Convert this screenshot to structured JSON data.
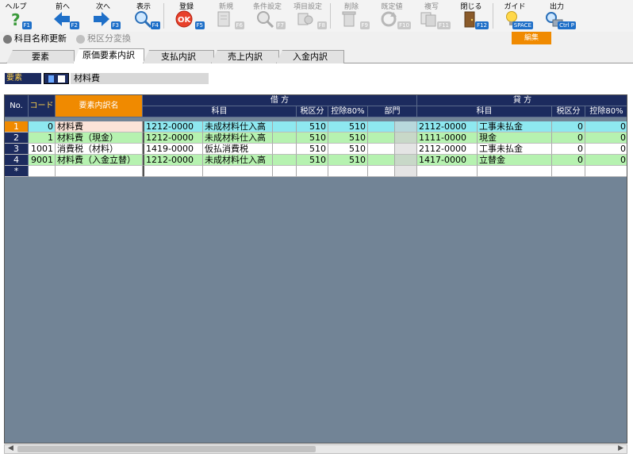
{
  "toolbar": {
    "help": {
      "label": "ヘルプ",
      "key": "F1"
    },
    "prev": {
      "label": "前へ",
      "key": "F2"
    },
    "next": {
      "label": "次へ",
      "key": "F3"
    },
    "view": {
      "label": "表示",
      "key": "F4"
    },
    "register": {
      "label": "登録",
      "key": "F5"
    },
    "new": {
      "label": "新規",
      "key": "F6"
    },
    "condition": {
      "label": "条件設定",
      "key": "F7"
    },
    "item": {
      "label": "項目設定",
      "key": "F8"
    },
    "delete": {
      "label": "削除",
      "key": "F9"
    },
    "default": {
      "label": "既定値",
      "key": "F10"
    },
    "copy": {
      "label": "複写",
      "key": "F11"
    },
    "close": {
      "label": "閉じる",
      "key": "F12"
    },
    "guide": {
      "label": "ガイド",
      "key": "SPACE"
    },
    "output": {
      "label": "出力",
      "key": "Ctrl P"
    }
  },
  "mode_badge": "編集",
  "subbar": {
    "update_names": "科目名称更新",
    "tax_convert": "税区分変換"
  },
  "tabs": [
    "要素",
    "原価要素内訳",
    "支払内訳",
    "売上内訳",
    "入金内訳"
  ],
  "element": {
    "label": "要素",
    "value": "材料費"
  },
  "grid": {
    "headers": {
      "no": "No.",
      "code": "コード",
      "name": "要素内訳名",
      "debit": "借 方",
      "credit": "貸 方",
      "account": "科目",
      "tax": "税区分",
      "deduct": "控除80%",
      "dept": "部門"
    },
    "rows": [
      {
        "no": "1",
        "code": "0",
        "name": "材料費",
        "d_code": "1212-0000",
        "d_name": "未成材料仕入高",
        "d_tax": "510",
        "d_ded": "510",
        "c_code": "2112-0000",
        "c_name": "工事未払金",
        "c_tax": "0",
        "c_ded": "0"
      },
      {
        "no": "2",
        "code": "1",
        "name": "材料費（現金）",
        "d_code": "1212-0000",
        "d_name": "未成材料仕入高",
        "d_tax": "510",
        "d_ded": "510",
        "c_code": "1111-0000",
        "c_name": "現金",
        "c_tax": "0",
        "c_ded": "0"
      },
      {
        "no": "3",
        "code": "1001",
        "name": "消費税（材料）",
        "d_code": "1419-0000",
        "d_name": "仮払消費税",
        "d_tax": "510",
        "d_ded": "510",
        "c_code": "2112-0000",
        "c_name": "工事未払金",
        "c_tax": "0",
        "c_ded": "0"
      },
      {
        "no": "4",
        "code": "9001",
        "name": "材料費（入金立替）",
        "d_code": "1212-0000",
        "d_name": "未成材料仕入高",
        "d_tax": "510",
        "d_ded": "510",
        "c_code": "1417-0000",
        "c_name": "立替金",
        "c_tax": "0",
        "c_ded": "0"
      }
    ],
    "new_row_marker": "*"
  },
  "colors": {
    "header": "#1c2b5e",
    "accent": "#f08a00",
    "row_selected": "#8ee8f0",
    "row_green": "#b6f2b0",
    "row_white": "#ffffff"
  }
}
